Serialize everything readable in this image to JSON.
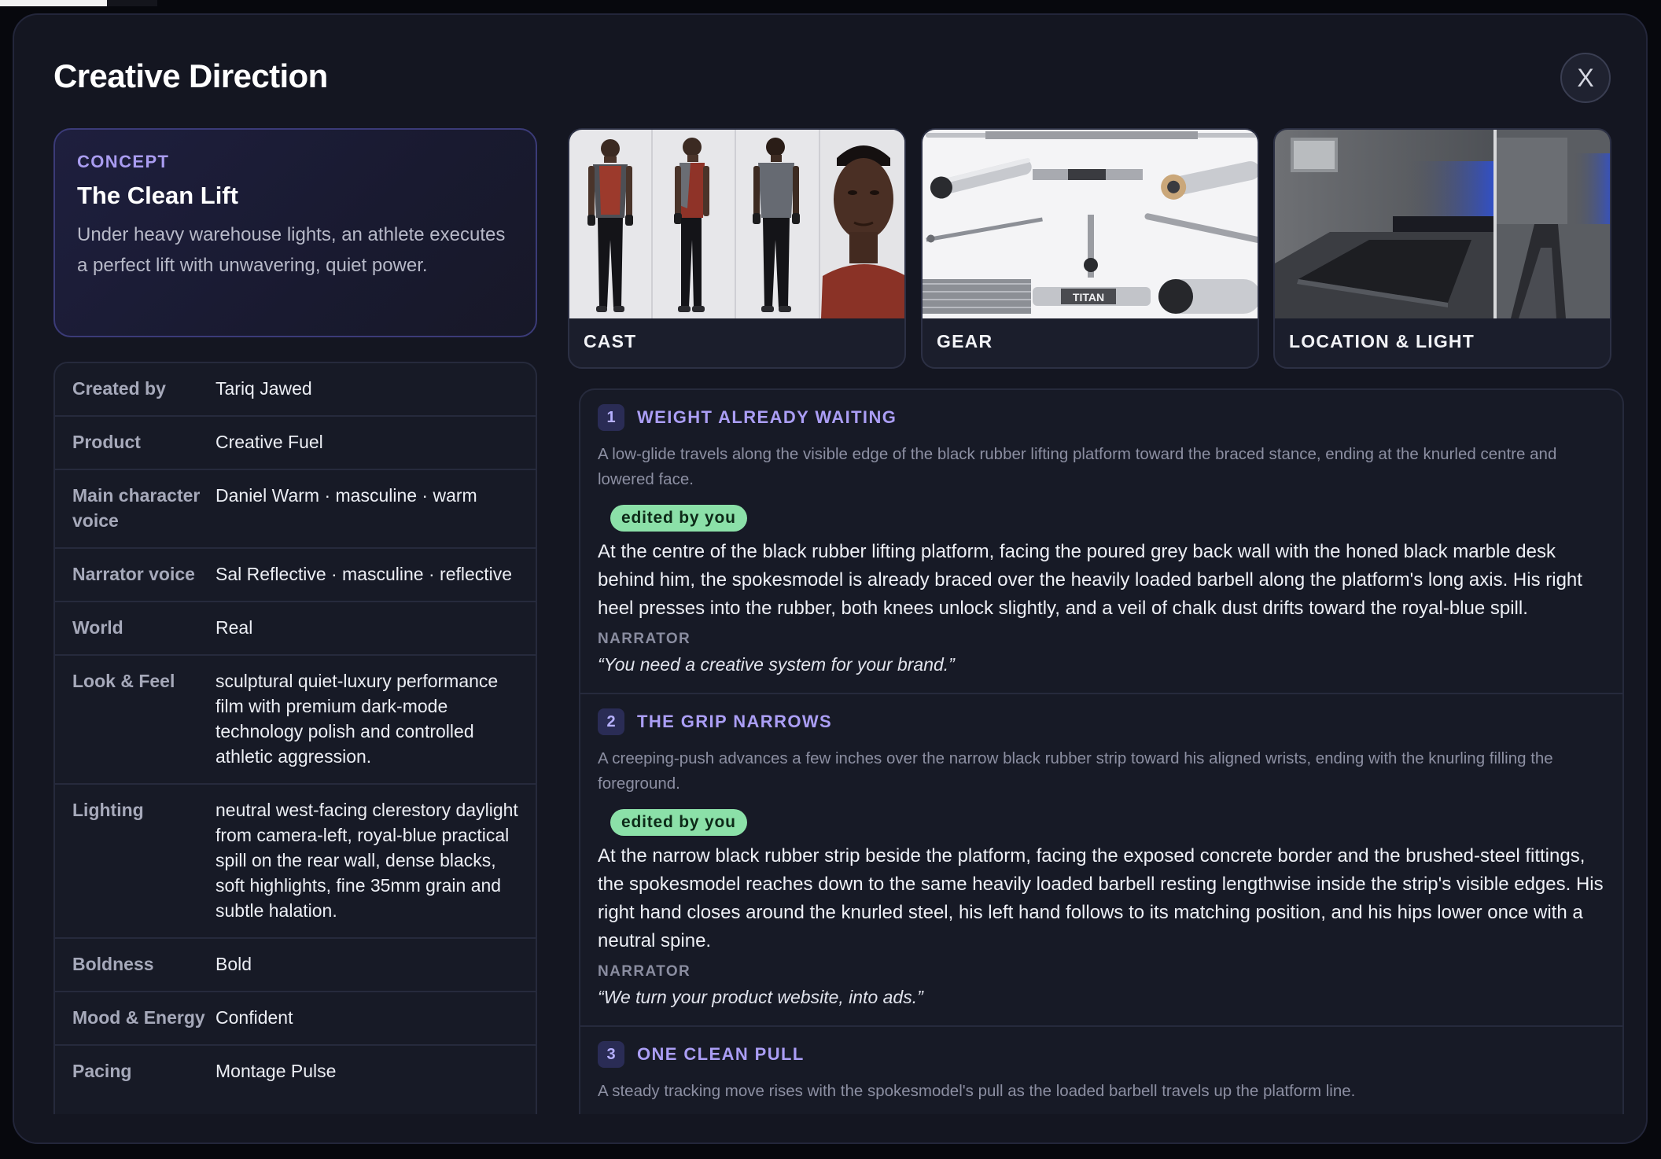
{
  "modal": {
    "title": "Creative Direction",
    "close_label": "X"
  },
  "concept": {
    "tag": "CONCEPT",
    "title": "The Clean Lift",
    "description": "Under heavy warehouse lights, an athlete executes a perfect lift with unwavering, quiet power."
  },
  "details": {
    "rows": [
      {
        "label": "Created by",
        "value": "Tariq Jawed"
      },
      {
        "label": "Product",
        "value": "Creative Fuel"
      },
      {
        "label": "Main character voice",
        "value": "Daniel Warm · masculine · warm"
      },
      {
        "label": "Narrator voice",
        "value": "Sal Reflective · masculine · reflective"
      },
      {
        "label": "World",
        "value": "Real"
      },
      {
        "label": "Look & Feel",
        "value": "sculptural quiet-luxury performance film with premium dark-mode technology polish and controlled athletic aggression."
      },
      {
        "label": "Lighting",
        "value": "neutral west-facing clerestory daylight from camera-left, royal-blue practical spill on the rear wall, dense blacks, soft highlights, fine 35mm grain and subtle halation."
      },
      {
        "label": "Boldness",
        "value": "Bold"
      },
      {
        "label": "Mood & Energy",
        "value": "Confident"
      },
      {
        "label": "Pacing",
        "value": "Montage Pulse"
      }
    ]
  },
  "references": {
    "cast": {
      "label": "CAST"
    },
    "gear": {
      "label": "GEAR",
      "brand_text": "TITAN"
    },
    "location": {
      "label": "LOCATION & LIGHT"
    }
  },
  "shots": [
    {
      "number": "1",
      "title": "WEIGHT ALREADY WAITING",
      "camera": "A low-glide travels along the visible edge of the black rubber lifting platform toward the braced stance, ending at the knurled centre and lowered face.",
      "badge": "edited by you",
      "action": "At the centre of the black rubber lifting platform, facing the poured grey back wall with the honed black marble desk behind him, the spokesmodel is already braced over the heavily loaded barbell along the platform's long axis. His right heel presses into the rubber, both knees unlock slightly, and a veil of chalk dust drifts toward the royal-blue spill.",
      "narrator_label": "NARRATOR",
      "narrator_line": "“You need a creative system for your brand.”"
    },
    {
      "number": "2",
      "title": "THE GRIP NARROWS",
      "camera": "A creeping-push advances a few inches over the narrow black rubber strip toward his aligned wrists, ending with the knurling filling the foreground.",
      "badge": "edited by you",
      "action": "At the narrow black rubber strip beside the platform, facing the exposed concrete border and the brushed-steel fittings, the spokesmodel reaches down to the same heavily loaded barbell resting lengthwise inside the strip's visible edges. His right hand closes around the knurled steel, his left hand follows to its matching position, and his hips lower once with a neutral spine.",
      "narrator_label": "NARRATOR",
      "narrator_line": "“We turn your product website, into ads.”"
    },
    {
      "number": "3",
      "title": "ONE CLEAN PULL",
      "camera": "A steady tracking move rises with the spokesmodel's pull as the loaded barbell travels up the platform line."
    }
  ]
}
